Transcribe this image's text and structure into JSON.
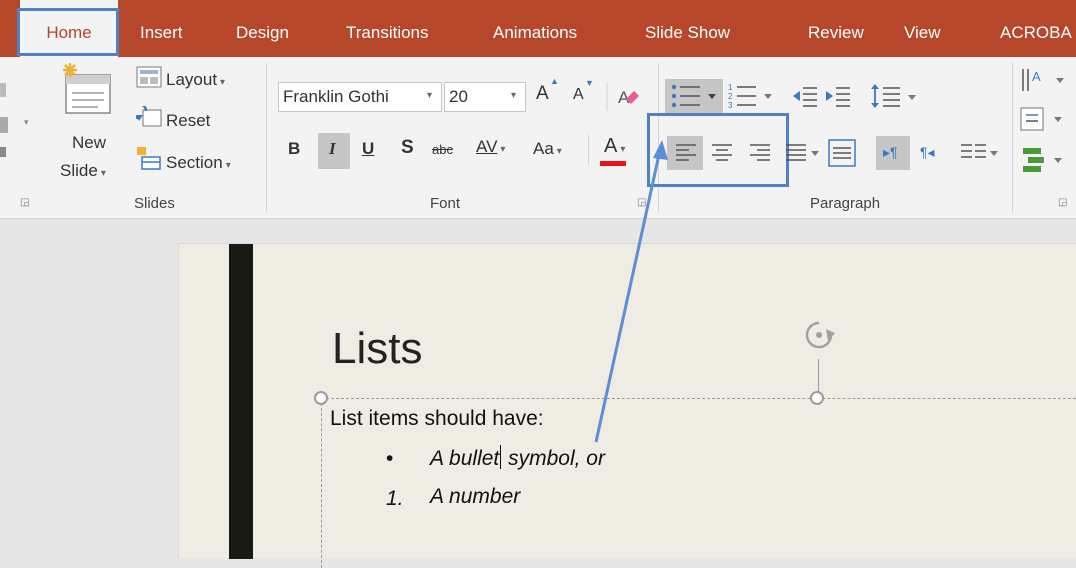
{
  "tabs": [
    {
      "label": "Home",
      "active": true
    },
    {
      "label": "Insert"
    },
    {
      "label": "Design"
    },
    {
      "label": "Transitions"
    },
    {
      "label": "Animations"
    },
    {
      "label": "Slide Show"
    },
    {
      "label": "Review"
    },
    {
      "label": "View"
    },
    {
      "label": "ACROBA"
    }
  ],
  "slides_group": {
    "new_slide_line1": "New",
    "new_slide_line2": "Slide",
    "layout": "Layout",
    "reset": "Reset",
    "section": "Section",
    "label": "Slides"
  },
  "font_group": {
    "font_name": "Franklin Gothi",
    "font_size": "20",
    "bold": "B",
    "italic": "I",
    "underline": "U",
    "shadow": "S",
    "strike": "abc",
    "spacing": "AV",
    "change_case": "Aa",
    "font_color": "A",
    "grow": "A",
    "shrink": "A",
    "label": "Font"
  },
  "paragraph_group": {
    "label": "Paragraph"
  },
  "slide": {
    "title": "Lists",
    "intro": "List items should have:",
    "bullet_symbol": "•",
    "bullet_text_before": "A bullet",
    "bullet_text_after": " symbol, or",
    "number_symbol": "1.",
    "number_text": "A number"
  },
  "colors": {
    "accent": "#b7472a",
    "highlight": "#4f81c7"
  }
}
